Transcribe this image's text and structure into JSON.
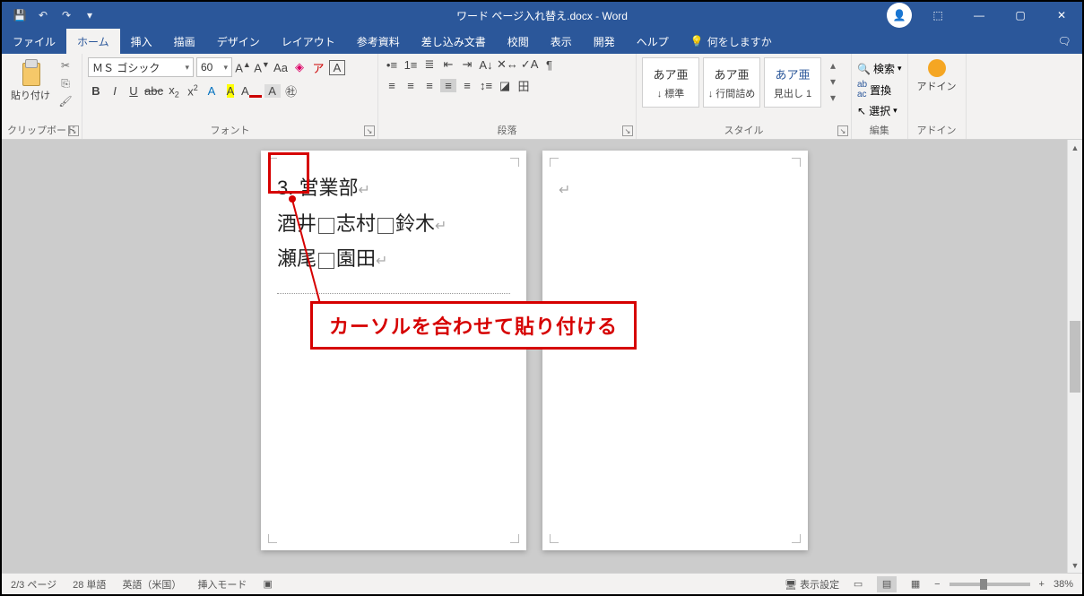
{
  "title": "ワード ページ入れ替え.docx - Word",
  "qat": {
    "save": "💾",
    "undo": "↶",
    "redo": "↷",
    "more": "▾"
  },
  "tabs": [
    "ファイル",
    "ホーム",
    "挿入",
    "描画",
    "デザイン",
    "レイアウト",
    "参考資料",
    "差し込み文書",
    "校閲",
    "表示",
    "開発",
    "ヘルプ"
  ],
  "active_tab": 1,
  "tellme": {
    "icon": "💡",
    "placeholder": "何をしますか"
  },
  "ribbon": {
    "clipboard": {
      "label": "クリップボード",
      "paste": "貼り付け",
      "cut": "✂",
      "copy": "⎘",
      "painter": "🖌"
    },
    "font": {
      "label": "フォント",
      "name": "ＭＳ ゴシック",
      "size": "60",
      "grow": "A",
      "shrink": "A",
      "case": "Aa",
      "clear": "◌",
      "phonetic": "ア",
      "charbox": "A",
      "bold": "B",
      "italic": "I",
      "underline": "U",
      "strike": "abc",
      "sub": "x₂",
      "sup": "x²",
      "effects": "A",
      "highlight": "A",
      "fontcolor": "A",
      "encircle": "㊛",
      "fit": "A"
    },
    "paragraph": {
      "label": "段落",
      "bullets": "≣",
      "numbering": "≣",
      "multilevel": "≣",
      "decIndent": "⇤",
      "incIndent": "⇥",
      "sort": "↕",
      "marks": "¶",
      "alignL": "≡",
      "alignC": "≡",
      "alignR": "≡",
      "alignJ": "≡",
      "alignD": "≡",
      "lineSpacing": "⇅",
      "shading": "◪",
      "borders": "田"
    },
    "styles": {
      "label": "スタイル",
      "items": [
        {
          "preview": "あア亜",
          "name": "↓ 標準"
        },
        {
          "preview": "あア亜",
          "name": "↓ 行間詰め"
        },
        {
          "preview": "あア亜",
          "name": "見出し 1"
        }
      ]
    },
    "editing": {
      "label": "編集",
      "find": "検索",
      "replace": "置換",
      "select": "選択"
    },
    "addins": {
      "label": "アドイン",
      "btn": "アドイン"
    }
  },
  "document": {
    "page1": {
      "line1_prefix": "3. ",
      "line1_text": "営業部",
      "line2_parts": [
        "酒井",
        "志村",
        "鈴木"
      ],
      "line3_parts": [
        "瀬尾",
        "園田"
      ]
    }
  },
  "annotation": {
    "text": "カーソルを合わせて貼り付ける"
  },
  "status": {
    "page": "2/3 ページ",
    "words": "28 単語",
    "lang": "英語（米国）",
    "mode": "挿入モード",
    "macro": "◇",
    "display": "表示設定",
    "zoom": "38%"
  }
}
